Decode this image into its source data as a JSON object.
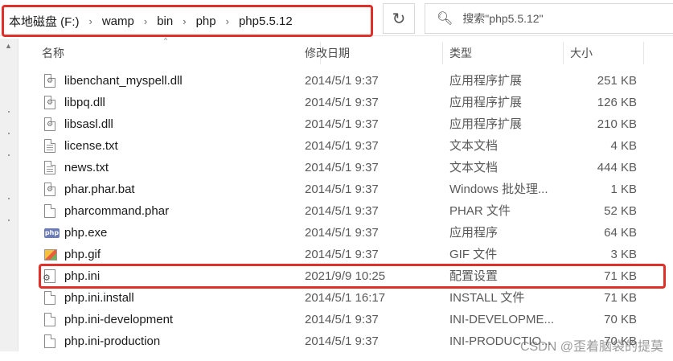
{
  "address_bar": {
    "crumbs": [
      "本地磁盘 (F:)",
      "wamp",
      "bin",
      "php",
      "php5.5.12"
    ]
  },
  "search": {
    "placeholder": "搜索\"php5.5.12\""
  },
  "columns": {
    "name": "名称",
    "date": "修改日期",
    "type": "类型",
    "size": "大小"
  },
  "files": [
    {
      "name": "libenchant_myspell.dll",
      "date": "2014/5/1 9:37",
      "type": "应用程序扩展",
      "size": "251 KB",
      "icon": "dll-icon"
    },
    {
      "name": "libpq.dll",
      "date": "2014/5/1 9:37",
      "type": "应用程序扩展",
      "size": "126 KB",
      "icon": "dll-icon"
    },
    {
      "name": "libsasl.dll",
      "date": "2014/5/1 9:37",
      "type": "应用程序扩展",
      "size": "210 KB",
      "icon": "dll-icon"
    },
    {
      "name": "license.txt",
      "date": "2014/5/1 9:37",
      "type": "文本文档",
      "size": "4 KB",
      "icon": "text-file-icon"
    },
    {
      "name": "news.txt",
      "date": "2014/5/1 9:37",
      "type": "文本文档",
      "size": "444 KB",
      "icon": "text-file-icon"
    },
    {
      "name": "phar.phar.bat",
      "date": "2014/5/1 9:37",
      "type": "Windows 批处理...",
      "size": "1 KB",
      "icon": "batch-file-icon"
    },
    {
      "name": "pharcommand.phar",
      "date": "2014/5/1 9:37",
      "type": "PHAR 文件",
      "size": "52 KB",
      "icon": "blank-file-icon"
    },
    {
      "name": "php.exe",
      "date": "2014/5/1 9:37",
      "type": "应用程序",
      "size": "64 KB",
      "icon": "php-exe-icon"
    },
    {
      "name": "php.gif",
      "date": "2014/5/1 9:37",
      "type": "GIF 文件",
      "size": "3 KB",
      "icon": "gif-image-icon"
    },
    {
      "name": "php.ini",
      "date": "2021/9/9 10:25",
      "type": "配置设置",
      "size": "71 KB",
      "icon": "ini-settings-icon",
      "highlighted": true
    },
    {
      "name": "php.ini.install",
      "date": "2014/5/1 16:17",
      "type": "INSTALL 文件",
      "size": "71 KB",
      "icon": "blank-file-icon"
    },
    {
      "name": "php.ini-development",
      "date": "2014/5/1 9:37",
      "type": "INI-DEVELOPME...",
      "size": "70 KB",
      "icon": "blank-file-icon"
    },
    {
      "name": "php.ini-production",
      "date": "2014/5/1 9:37",
      "type": "INI-PRODUCTIO...",
      "size": "70 KB",
      "icon": "blank-file-icon"
    }
  ],
  "watermark": "CSDN @歪着脑袋的提莫",
  "icons": {
    "refresh": "refresh-icon",
    "search": "search-icon",
    "breadcrumb_separator": "chevron-right-icon"
  },
  "colors": {
    "highlight_border": "#e0302a"
  }
}
